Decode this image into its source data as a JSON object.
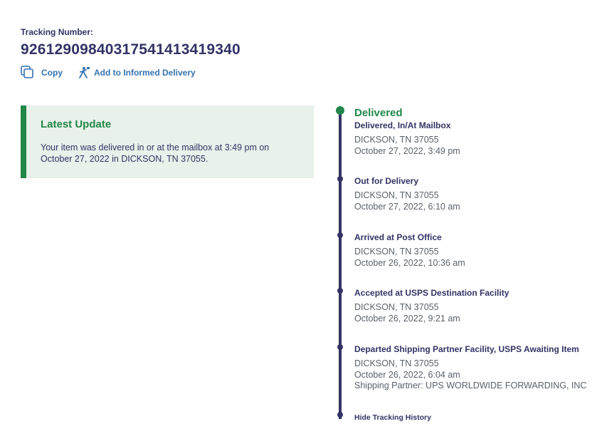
{
  "tracking": {
    "label": "Tracking Number:",
    "number": "9261290984031754141341934​0",
    "copy_label": "Copy",
    "informed_label": "Add to Informed Delivery"
  },
  "latest_update": {
    "title": "Latest Update",
    "message": "Your item was delivered in or at the mailbox at 3:49 pm on October 27, 2022 in DICKSON, TN 37055."
  },
  "timeline": {
    "current_status": "Delivered",
    "events": [
      {
        "title": "Delivered, In/At Mailbox",
        "location": "DICKSON, TN 37055",
        "datetime": "October 27, 2022, 3:49 pm"
      },
      {
        "title": "Out for Delivery",
        "location": "DICKSON, TN 37055",
        "datetime": "October 27, 2022, 6:10 am"
      },
      {
        "title": "Arrived at Post Office",
        "location": "DICKSON, TN 37055",
        "datetime": "October 26, 2022, 10:36 am"
      },
      {
        "title": "Accepted at USPS Destination Facility",
        "location": "DICKSON, TN 37055",
        "datetime": "October 26, 2022, 9:21 am"
      },
      {
        "title": "Departed Shipping Partner Facility, USPS Awaiting Item",
        "location": "DICKSON, TN 37055",
        "datetime": "October 26, 2022, 6:04 am",
        "note": "Shipping Partner: UPS WORLDWIDE FORWARDING, INC"
      }
    ],
    "hide_label": "Hide Tracking History"
  },
  "colors": {
    "navy": "#333366",
    "green": "#218748",
    "link_blue": "#3573b1",
    "panel_bg": "#e8f1ea",
    "gray_text": "#5b616b"
  },
  "icons": {
    "copy": "copy-icon",
    "informed": "informed-delivery-icon"
  }
}
